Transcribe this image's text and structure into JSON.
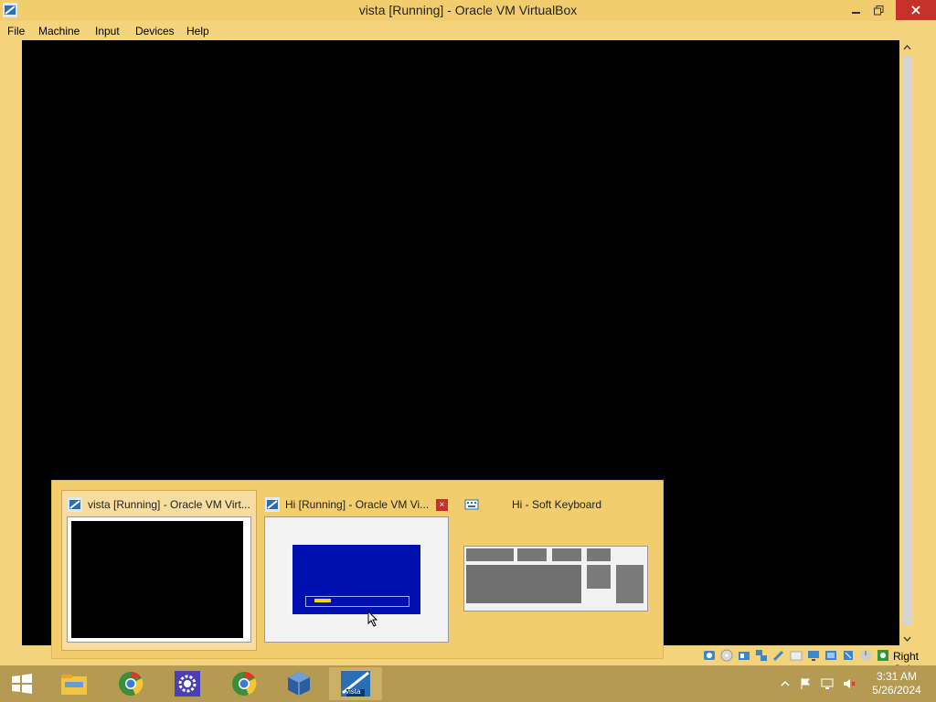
{
  "window": {
    "title": "vista [Running] - Oracle VM VirtualBox",
    "icon": "virtualbox-icon"
  },
  "menu": {
    "items": [
      "File",
      "Machine",
      "Input",
      "Devices",
      "Help"
    ]
  },
  "statusbar": {
    "host_key": "Right Ctrl",
    "icons": [
      "hard-disk-icon",
      "optical-drive-icon",
      "audio-icon",
      "network-icon",
      "usb-icon",
      "shared-folders-icon",
      "display-icon",
      "video-capture-icon",
      "cpu-icon",
      "mouse-integration-icon",
      "host-key-indicator-icon"
    ]
  },
  "switcher": {
    "items": [
      {
        "title": "vista [Running] - Oracle VM Virt...",
        "icon": "virtualbox-icon",
        "selected": true
      },
      {
        "title": "Hi [Running] - Oracle VM Vi...",
        "icon": "virtualbox-icon",
        "selected": false,
        "close": "×"
      },
      {
        "title": "Hi - Soft Keyboard",
        "icon": "keyboard-icon",
        "selected": false
      }
    ]
  },
  "taskbar": {
    "buttons": [
      "windows-start-icon",
      "file-explorer-icon",
      "chrome-icon",
      "settings-icon",
      "chrome-icon",
      "virtualbox-icon",
      "vista-vm-icon"
    ],
    "tray_icons": [
      "show-hidden-icons-icon",
      "flag-icon",
      "network-icon",
      "speaker-muted-icon"
    ],
    "time": "3:31 AM",
    "date": "5/26/2024",
    "vista_label": "vista"
  },
  "colors": {
    "title_bar": "#f2cd6e",
    "chrome_bg": "#f3d37c",
    "close_red": "#c7312b",
    "taskbar": "#b49a52",
    "vm_screen": "#000000"
  }
}
